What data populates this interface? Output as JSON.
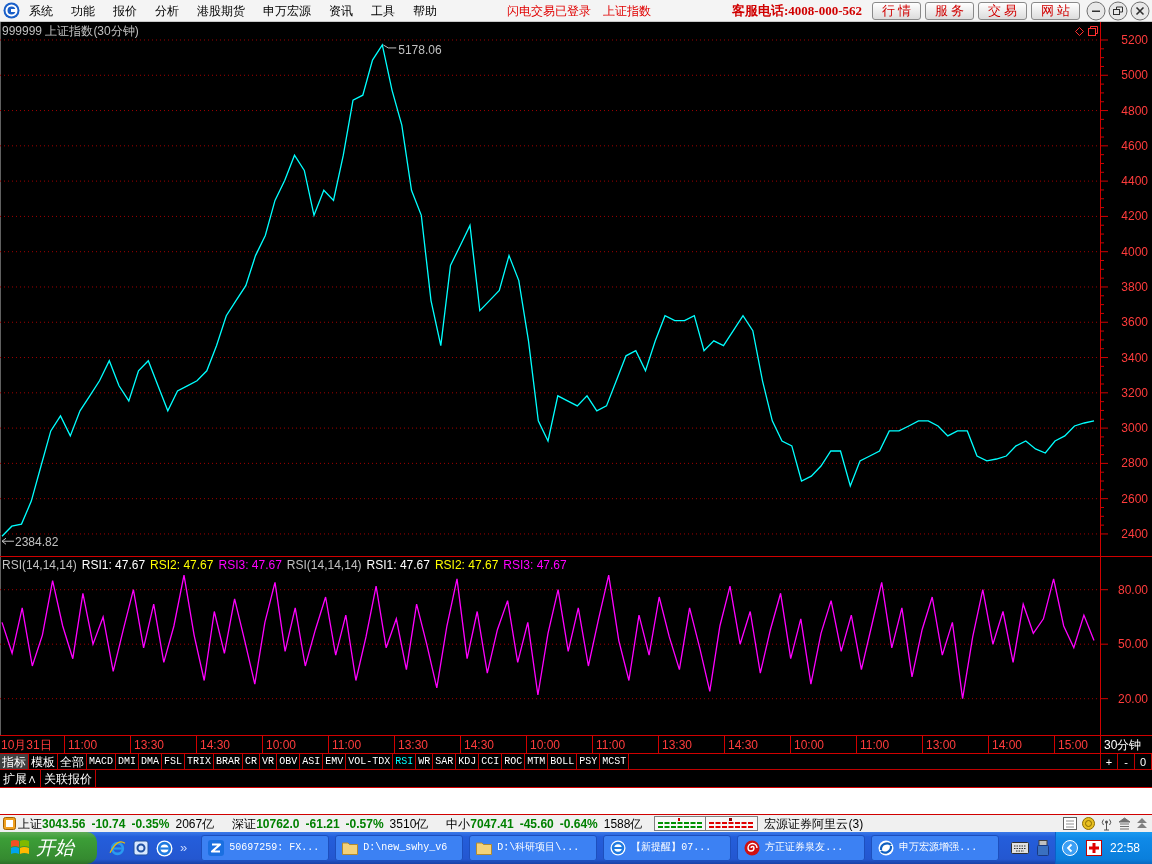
{
  "menu_bar": {
    "items": [
      "系统",
      "功能",
      "报价",
      "分析",
      "港股期货",
      "申万宏源",
      "资讯",
      "工具",
      "帮助"
    ],
    "notices": [
      "闪电交易已登录",
      "上证指数"
    ],
    "hotline": "客服电话:4008-000-562",
    "quick_buttons": [
      "行 情",
      "服 务",
      "交 易",
      "网 站"
    ]
  },
  "price_chart": {
    "chart_data": {
      "type": "line",
      "title": "999999 上证指数(30分钟)",
      "series": [
        {
          "color": "#00ffff",
          "values": [
            2387,
            2444,
            2456,
            2586,
            2785,
            2984,
            3069,
            2956,
            3098,
            3183,
            3268,
            3382,
            3240,
            3154,
            3325,
            3382,
            3240,
            3098,
            3211,
            3240,
            3268,
            3325,
            3467,
            3637,
            3723,
            3808,
            3978,
            4092,
            4291,
            4405,
            4547,
            4461,
            4206,
            4348,
            4291,
            4547,
            4859,
            4887,
            5086,
            5172,
            4916,
            4717,
            4348,
            4206,
            3723,
            3467,
            3922,
            4035,
            4149,
            3666,
            3723,
            3780,
            3978,
            3836,
            3495,
            3041,
            2927,
            3183,
            3154,
            3126,
            3183,
            3098,
            3126,
            3268,
            3410,
            3439,
            3325,
            3495,
            3637,
            3609,
            3609,
            3637,
            3439,
            3495,
            3467,
            3552,
            3637,
            3552,
            3268,
            3041,
            2927,
            2899,
            2700,
            2728,
            2785,
            2870,
            2870,
            2672,
            2814,
            2842,
            2870,
            2984,
            2984,
            3012,
            3041,
            3041,
            3012,
            2956,
            2984,
            2984,
            2842,
            2814,
            2825,
            2842,
            2899,
            2927,
            2882,
            2859,
            2927,
            2956,
            3012,
            3029,
            3041
          ]
        }
      ],
      "ylim": [
        2275,
        5302
      ],
      "yticks": [
        2400,
        2600,
        2800,
        3000,
        3200,
        3400,
        3600,
        3800,
        4000,
        4200,
        4400,
        4600,
        4800,
        5000,
        5200
      ],
      "grid": true,
      "annotations": [
        "5178.06",
        "2384.82"
      ]
    }
  },
  "rsi_panel": {
    "legend": [
      {
        "text": "RSI(14,14,14)"
      },
      {
        "text": "RSI1: 47.67",
        "color": "#ffffff"
      },
      {
        "text": "RSI2: 47.67",
        "color": "#ffff00"
      },
      {
        "text": "RSI3: 47.67",
        "color": "#ff00ff"
      },
      {
        "text": "RSI(14,14,14)"
      },
      {
        "text": "RSI1: 47.67",
        "color": "#ffffff"
      },
      {
        "text": "RSI2: 47.67",
        "color": "#ffff00"
      },
      {
        "text": "RSI3: 47.67",
        "color": "#ff00ff"
      }
    ],
    "chart_data": {
      "type": "line",
      "series": [
        {
          "color": "#ff00ff",
          "values": [
            62,
            45,
            70,
            38,
            55,
            85,
            60,
            42,
            78,
            50,
            65,
            35,
            58,
            80,
            48,
            72,
            40,
            60,
            88,
            55,
            30,
            68,
            45,
            75,
            52,
            28,
            62,
            84,
            46,
            70,
            38,
            58,
            76,
            44,
            66,
            30,
            54,
            82,
            48,
            64,
            36,
            72,
            50,
            26,
            60,
            86,
            42,
            68,
            34,
            58,
            74,
            40,
            62,
            22,
            56,
            80,
            46,
            70,
            38,
            64,
            88,
            52,
            30,
            66,
            44,
            76,
            54,
            36,
            70,
            48,
            24,
            60,
            82,
            50,
            68,
            34,
            58,
            78,
            42,
            64,
            28,
            56,
            74,
            46,
            66,
            36,
            60,
            84,
            48,
            70,
            32,
            58,
            76,
            44,
            62,
            20,
            54,
            80,
            50,
            68,
            40,
            72,
            56,
            64,
            86,
            60,
            48,
            66,
            52
          ]
        }
      ],
      "ylim": [
        0,
        98
      ],
      "yticks": [
        {
          "value": 20,
          "label": "20.00"
        },
        {
          "value": 50,
          "label": "50.00"
        },
        {
          "value": 80,
          "label": "80.00"
        }
      ],
      "grid": true
    }
  },
  "time_axis": {
    "labels": [
      "10月31日",
      "11:00",
      "13:30",
      "14:30",
      "10:00",
      "11:00",
      "13:30",
      "14:30",
      "10:00",
      "11:00",
      "13:30",
      "14:30",
      "10:00",
      "11:00",
      "13:00",
      "14:00",
      "15:00"
    ],
    "period": "30分钟"
  },
  "indicator_bar": {
    "groups": [
      {
        "label": "指标",
        "selected": true
      },
      {
        "label": "模板",
        "selected": false
      },
      {
        "label": "全部",
        "selected": false
      }
    ],
    "indicators": [
      {
        "label": "MACD",
        "selected": false
      },
      {
        "label": "DMI",
        "selected": false
      },
      {
        "label": "DMA",
        "selected": false
      },
      {
        "label": "FSL",
        "selected": false
      },
      {
        "label": "TRIX",
        "selected": false
      },
      {
        "label": "BRAR",
        "selected": false
      },
      {
        "label": "CR",
        "selected": false
      },
      {
        "label": "VR",
        "selected": false
      },
      {
        "label": "OBV",
        "selected": false
      },
      {
        "label": "ASI",
        "selected": false
      },
      {
        "label": "EMV",
        "selected": false
      },
      {
        "label": "VOL-TDX",
        "selected": false
      },
      {
        "label": "RSI",
        "selected": true
      },
      {
        "label": "WR",
        "selected": false
      },
      {
        "label": "SAR",
        "selected": false
      },
      {
        "label": "KDJ",
        "selected": false
      },
      {
        "label": "CCI",
        "selected": false
      },
      {
        "label": "ROC",
        "selected": false
      },
      {
        "label": "MTM",
        "selected": false
      },
      {
        "label": "BOLL",
        "selected": false
      },
      {
        "label": "PSY",
        "selected": false
      },
      {
        "label": "MCST",
        "selected": false
      }
    ],
    "controls": [
      "+",
      "-",
      "0"
    ]
  },
  "bottom_tabs": [
    "扩展∧",
    "关联报价"
  ],
  "status_bar": {
    "indices": [
      {
        "name": "上证",
        "value": "3043.56",
        "change": "-10.74",
        "percent": "-0.35%",
        "amount": "2067亿",
        "color": "#008000"
      },
      {
        "name": "深证",
        "value": "10762.0",
        "change": "-61.21",
        "percent": "-0.57%",
        "amount": "3510亿",
        "color": "#008000"
      },
      {
        "name": "中小",
        "value": "7047.41",
        "change": "-45.60",
        "percent": "-0.64%",
        "amount": "1588亿",
        "color": "#008000"
      }
    ],
    "server": "宏源证券阿里云(3)"
  },
  "taskbar": {
    "start": "开始",
    "more": "»",
    "tasks": [
      {
        "label": "50697259: FX...",
        "kind": "messenger"
      },
      {
        "label": "D:\\new_swhy_v6",
        "kind": "folder"
      },
      {
        "label": "D:\\科研项目\\...",
        "kind": "folder"
      },
      {
        "label": "【新提醒】07...",
        "kind": "browser"
      },
      {
        "label": "方正证券泉友...",
        "kind": "spiral"
      },
      {
        "label": "申万宏源增强...",
        "kind": "swirl"
      }
    ],
    "clock": "22:58"
  }
}
